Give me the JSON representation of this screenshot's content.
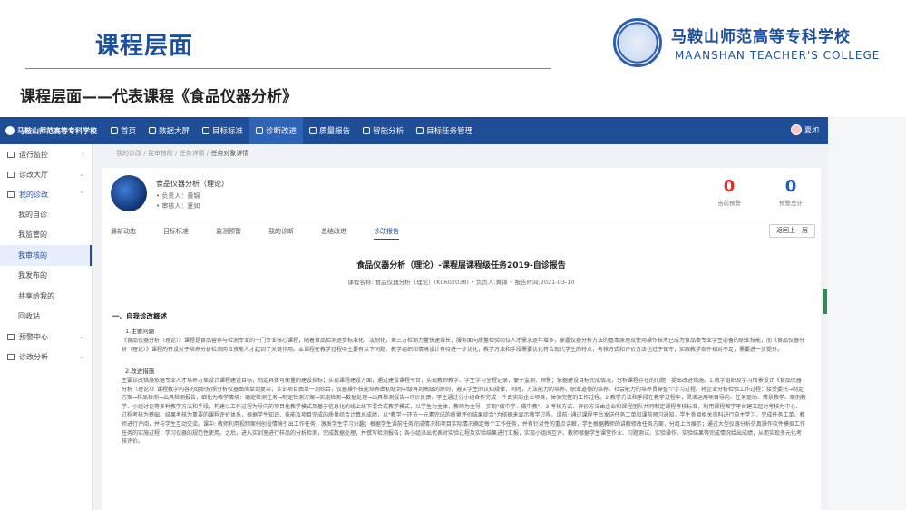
{
  "slide": {
    "title": "课程层面",
    "subtitle": "课程层面——代表课程《食品仪器分析》",
    "college_cn": "马鞍山师范高等专科学校",
    "college_en": "MAANSHAN TEACHER'S COLLEGE"
  },
  "app": {
    "brand": "马鞍山师范高等专科学校",
    "nav": [
      "首页",
      "数据大屏",
      "目标标准",
      "诊断改进",
      "质量报告",
      "智能分析",
      "目标任务管理"
    ],
    "active_nav": "诊断改进",
    "user": "夏如"
  },
  "sidebar": {
    "items": [
      {
        "label": "运行监控",
        "arrow": "‹"
      },
      {
        "label": "诊改大厅",
        "arrow": "⌄"
      },
      {
        "label": "我的诊改",
        "arrow": "⌃"
      },
      {
        "label": "预警中心",
        "arrow": "⌄"
      },
      {
        "label": "诊改分析",
        "arrow": "⌄"
      }
    ],
    "sub_items": [
      "我的自诊",
      "我监管的",
      "我审核的",
      "我发布的",
      "共享给我的",
      "回收站"
    ],
    "selected": "我审核的"
  },
  "breadcrumb": [
    "我的诊改",
    "我审核的",
    "任务详情",
    "任务对象详情"
  ],
  "course": {
    "name": "食品仪器分析（理论）",
    "owner": "• 负责人：黄锦",
    "reviewer": "• 审核人：夏如",
    "stats": [
      {
        "value": "0",
        "label": "当前预警",
        "color": "#d9342b"
      },
      {
        "value": "0",
        "label": "预警总计",
        "color": "#1f5fbf"
      }
    ]
  },
  "tabs": [
    "最新动态",
    "目标标准",
    "监测预警",
    "我的诊断",
    "总结改进",
    "诊改报告"
  ],
  "active_tab": "诊改报告",
  "back_button": "返回上一层",
  "report": {
    "title": "食品仪器分析（理论）-课程层课程级任务2019-自诊报告",
    "meta": "课程名称: 食品仪器分析（理论）(K0602038) • 负责人:黄锦 • 报告时间:2021-03-10",
    "section1": "一、自我诊改概述",
    "sub1": "1.主要问题",
    "para1": "《食品仪器分析（理论）》课程是食品营养与检测专业的一门专业核心课程，随着食品检测逐步标准化、法制化，第三方检测力量快速增长，服务面向质量检验岗位人才需求逐年增多，掌握仪器分析方法的基本原理及使用操作技术已成为食品类专业学生必备的职业技能，而《食品仪器分析（理论）》课程的开设对于培养分析检测岗位技能人才起到了关键作用。本课程在教学过程中主要有以下问题：教学组织和情境设计有待进一步优化；教学方法和手段需要优化符合现代学生的特点；考核方式和评价方法也过于保守；实践教学条件相对不足，需要进一步提升。",
    "sub2": "2.改进措施",
    "para2": "主要诊改措施依据专业人才培养方案设计课程建设目标，制定具体可衡量的建设指标；实现课程建设方面，通过建设课程平台，实现教师教学、学生学习全程记录，便于监测、预警；依据建设目标完成情况，分析课程存在的问题，提出改进措施。1.教学组织及学习情景设计《食品仪器分析（理论）》课程教学内容的组织按照分析仪器由简单到复杂，实训项目由单一到综合，仪器操作技能培养由初级到中级再到高级的原则，遵从学生的认知规律，同时，方法能力的培养、职业道德的培养、社会能力的培养贯穿整个学习过程。将企业分析检验工作过程：接受委托→制定方案→样品检测→出具检测报告，细化为教学情境：确定检测任务→制定检测方案→实施检测→数据处理→出具检测报告→评价反馈，学生通过分小组合作完成一个真实的企业项目，体验完整的工作过程。2.教学方法和手段在教学过程中，灵活运用项目导向、任务驱动、情景教学、案例教学、小组讨论等多种教学方法和手段，构建以工作过程为导向的项目化教学模式及基于信息化的线上线下混合式教学模式，以学生为主体，教师为主导，实现\"做中学、做中教\"。3.考核方式、评价方法由企业和课程团队共同制定课程考核标准，利用课程教学平台建立起对考核为中心、过程考核为基础、结果考核为重要的课程评价体系，根据学生知识、技能及项目完成的质量综合计算总成绩，以\"教学一环节一元素完成的质量评价结果综合\"为依据来显示教学过程。课前: 通过课程平台发送任务工单和课前预习通知，学生查阅相关资料进行自主学习，完成任务工单。教师进行评阅，并与学生互动交流。课中: 教师利用视频案例创设情境引出工作任务，激发学生学习兴趣；根据学生课前任务完成情况和项目实际情况确定每个工作任务，并有针对性的重点讲解，学生根据教师的讲解修改任务方案，分组上台展示；通过大型仪器分析仿真操作软件模拟工作任务的实施过程，学习仪器的规范性使用。之后，进入实训室进行样品的分析检测，完成数据处理，并撰写检测报告；各小组派出代表对实验过程及实验结果进行汇报，实现小组间互评。教师根据学生课堂作业、习题测试、实验操作、实验结果等完成情况给出成绩，从而实现多元化考核评价。"
  }
}
